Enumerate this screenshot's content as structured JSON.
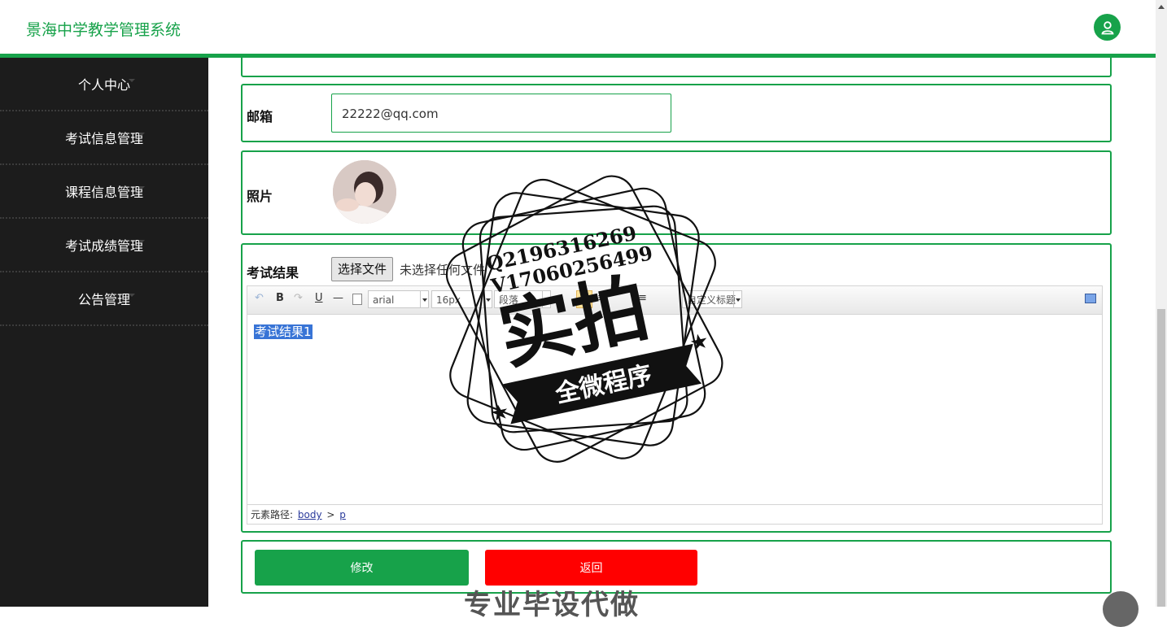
{
  "header": {
    "title": "景海中学教学管理系统",
    "user_icon": "user-icon"
  },
  "sidebar": {
    "items": [
      {
        "label": "个人中心"
      },
      {
        "label": "考试信息管理"
      },
      {
        "label": "课程信息管理"
      },
      {
        "label": "考试成绩管理"
      },
      {
        "label": "公告管理"
      }
    ]
  },
  "form": {
    "email": {
      "label": "邮箱",
      "value": "22222@qq.com"
    },
    "photo": {
      "label": "照片"
    },
    "result": {
      "label": "考试结果",
      "file_button": "选择文件",
      "file_status": "未选择任何文件",
      "editor": {
        "font_family": "arial",
        "font_size": "16px",
        "paragraph": "段落",
        "custom_heading": "自定义标题",
        "content": "考试结果1",
        "path_label": "元素路径:",
        "path_body": "body",
        "path_sep": ">",
        "path_p": "p"
      }
    },
    "buttons": {
      "modify": "修改",
      "back": "返回"
    }
  },
  "watermark": {
    "contact_q": "Q2196316269",
    "contact_v": "V17060256499",
    "main_text": "实拍",
    "banner_text": "全微程序",
    "bottom_text": "专业毕设代做"
  },
  "colors": {
    "accent": "#17a24a",
    "danger": "#ff0000",
    "sidebar_bg": "#1c1c1c"
  }
}
